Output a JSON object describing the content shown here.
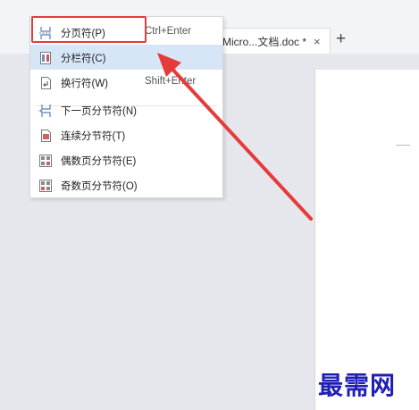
{
  "tab": {
    "title": "Micro...文档.doc *",
    "close_glyph": "×",
    "add_glyph": "+"
  },
  "menu": {
    "items": [
      {
        "icon": "page-break-icon",
        "label": "分页符(P)",
        "shortcut": "Ctrl+Enter"
      },
      {
        "icon": "column-break-icon",
        "label": "分栏符(C)",
        "shortcut": "",
        "highlighted": true
      },
      {
        "icon": "line-break-icon",
        "label": "换行符(W)",
        "shortcut": "Shift+Enter"
      },
      {
        "icon": "next-page-section-break-icon",
        "label": "下一页分节符(N)",
        "shortcut": ""
      },
      {
        "icon": "continuous-section-break-icon",
        "label": "连续分节符(T)",
        "shortcut": ""
      },
      {
        "icon": "even-page-section-break-icon",
        "label": "偶数页分节符(E)",
        "shortcut": ""
      },
      {
        "icon": "odd-page-section-break-icon",
        "label": "奇数页分节符(O)",
        "shortcut": ""
      }
    ]
  },
  "watermark": "最需网",
  "colors": {
    "highlight_box": "#e63b3b",
    "selected_item": "#d7e6f7",
    "watermark": "#1f1fb5",
    "workspace": "#e6e7ec"
  }
}
